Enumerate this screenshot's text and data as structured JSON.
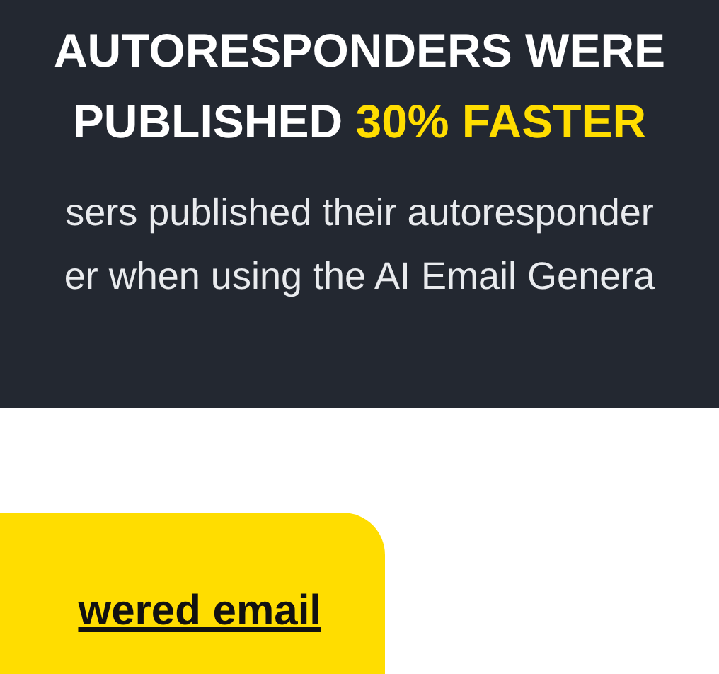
{
  "banner": {
    "heading": {
      "line_1": "AUTORESPONDERS WERE",
      "line_2": "PUBLISHED",
      "highlight": "30% FASTER"
    },
    "body_lines": [
      "sers published their autoresponder",
      "er when using the AI Email Genera"
    ]
  },
  "cta_button": {
    "label": "wered email"
  }
}
